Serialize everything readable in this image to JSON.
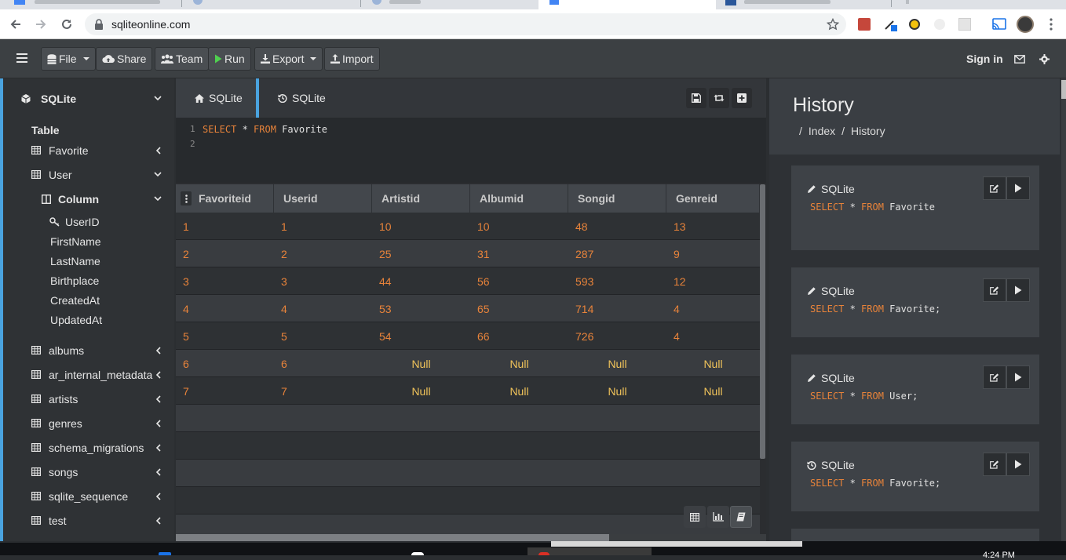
{
  "browser": {
    "url": "sqliteonline.com",
    "taskbar_time": "4:24 PM"
  },
  "toolbar": {
    "file": "File",
    "share": "Share",
    "team": "Team",
    "run": "Run",
    "export": "Export",
    "import": "Import",
    "signin": "Sign in"
  },
  "sidebar": {
    "db_name": "SQLite",
    "section_label": "Table",
    "column_label": "Column",
    "tables_top": [
      "Favorite",
      "User"
    ],
    "user_columns": [
      "UserID",
      "FirstName",
      "LastName",
      "Birthplace",
      "CreatedAt",
      "UpdatedAt"
    ],
    "tables_rest": [
      "albums",
      "ar_internal_metadata",
      "artists",
      "genres",
      "schema_migrations",
      "songs",
      "sqlite_sequence",
      "test"
    ]
  },
  "editor": {
    "tab1": "SQLite",
    "tab2": "SQLite",
    "line_numbers": [
      "1",
      "2"
    ],
    "query_kw1": "SELECT",
    "query_mid": " * ",
    "query_kw2": "FROM",
    "query_table": " Favorite"
  },
  "grid": {
    "columns": [
      "Favoriteid",
      "Userid",
      "Artistid",
      "Albumid",
      "Songid",
      "Genreid"
    ],
    "rows": [
      [
        "1",
        "1",
        "10",
        "10",
        "48",
        "13"
      ],
      [
        "2",
        "2",
        "25",
        "31",
        "287",
        "9"
      ],
      [
        "3",
        "3",
        "44",
        "56",
        "593",
        "12"
      ],
      [
        "4",
        "4",
        "53",
        "65",
        "714",
        "4"
      ],
      [
        "5",
        "5",
        "54",
        "66",
        "726",
        "4"
      ],
      [
        "6",
        "6",
        "Null",
        "Null",
        "Null",
        "Null"
      ],
      [
        "7",
        "7",
        "Null",
        "Null",
        "Null",
        "Null"
      ]
    ]
  },
  "history": {
    "title": "History",
    "crumb_index": "Index",
    "crumb_history": "History",
    "items": [
      {
        "label": "SQLite",
        "icon": "pencil-icon",
        "kw1": "SELECT",
        "mid": " * ",
        "kw2": "FROM",
        "rest": " Favorite"
      },
      {
        "label": "SQLite",
        "icon": "pencil-icon",
        "kw1": "SELECT",
        "mid": " * ",
        "kw2": "FROM",
        "rest": " Favorite;"
      },
      {
        "label": "SQLite",
        "icon": "pencil-icon",
        "kw1": "SELECT",
        "mid": " * ",
        "kw2": "FROM",
        "rest": " User;"
      },
      {
        "label": "SQLite",
        "icon": "history-icon",
        "kw1": "SELECT",
        "mid": " * ",
        "kw2": "FROM",
        "rest": " Favorite;"
      }
    ]
  },
  "colors": {
    "accent": "#4aa3df",
    "keyword": "#e8833a",
    "null_value": "#f0c35a"
  }
}
